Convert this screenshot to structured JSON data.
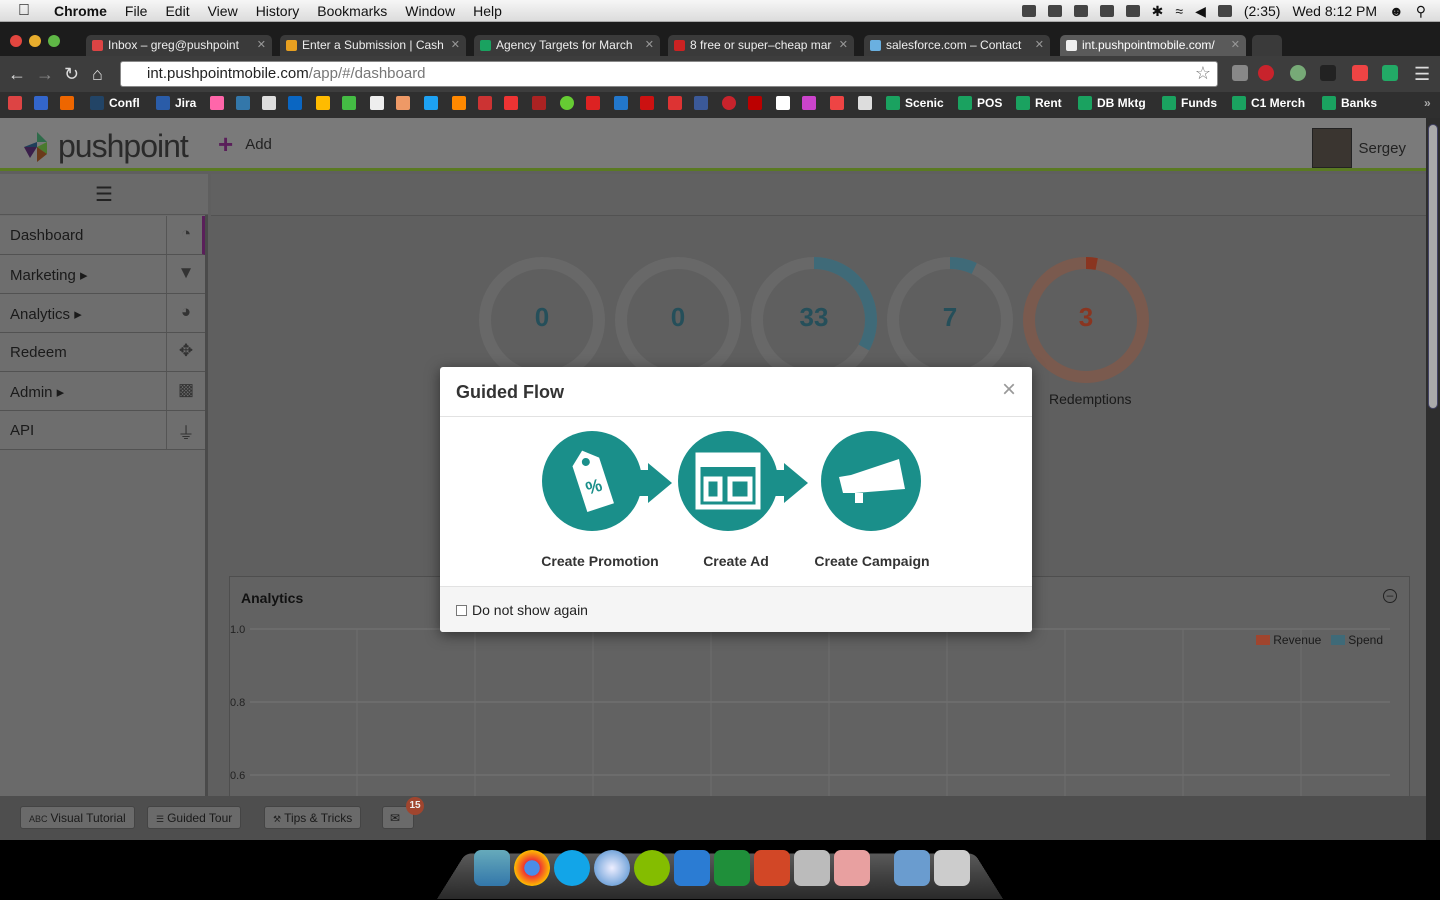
{
  "menubar": {
    "app": "Chrome",
    "items": [
      "File",
      "Edit",
      "View",
      "History",
      "Bookmarks",
      "Window",
      "Help"
    ],
    "battery": "(2:35)",
    "clock": "Wed 8:12 PM"
  },
  "tabs": [
    {
      "label": "Inbox – greg@pushpoint",
      "color": "#d44"
    },
    {
      "label": "Enter a Submission | Cash",
      "color": "#e8a020"
    },
    {
      "label": "Agency Targets for March",
      "color": "#1aa260"
    },
    {
      "label": "8 free or super–cheap mar",
      "color": "#c22"
    },
    {
      "label": "salesforce.com – Contact",
      "color": "#6ab0e0"
    },
    {
      "label": "int.pushpointmobile.com/",
      "color": "#eee"
    }
  ],
  "omnibox": {
    "host": "int.pushpointmobile.com",
    "path": "/app/#/dashboard"
  },
  "bookmarks": [
    {
      "label": "Confl"
    },
    {
      "label": "Jira"
    },
    {
      "label": "Scenic"
    },
    {
      "label": "POS"
    },
    {
      "label": "Rent"
    },
    {
      "label": "DB Mktg"
    },
    {
      "label": "Funds"
    },
    {
      "label": "C1 Merch"
    },
    {
      "label": "Banks"
    }
  ],
  "header": {
    "brand": "pushpoint",
    "add_label": "Add",
    "user_name": "Sergey"
  },
  "sidebar": {
    "items": [
      {
        "label": "Dashboard",
        "icon": "gauge-icon"
      },
      {
        "label": "Marketing ▸",
        "icon": "funnel-icon"
      },
      {
        "label": "Analytics ▸",
        "icon": "pie-icon"
      },
      {
        "label": "Redeem",
        "icon": "redeem-icon"
      },
      {
        "label": "Admin ▸",
        "icon": "briefcase-icon"
      },
      {
        "label": "API",
        "icon": "plug-icon"
      }
    ]
  },
  "stats": [
    {
      "value": "0",
      "fill": 0,
      "color": "#254f5a"
    },
    {
      "value": "0",
      "fill": 0,
      "color": "#254f5a"
    },
    {
      "value": "33",
      "fill": 0.33,
      "color": "#254f5a"
    },
    {
      "value": "7",
      "fill": 0.07,
      "color": "#254f5a"
    },
    {
      "value": "3",
      "fill": 0.03,
      "color": "#8a3520",
      "label": "Redemptions"
    }
  ],
  "analytics": {
    "title": "Analytics",
    "chart_data": {
      "type": "line",
      "ylim": [
        0.6,
        1.0
      ],
      "yticks": [
        "1.0",
        "0.8",
        "0.6"
      ],
      "series": [
        {
          "name": "Revenue",
          "color": "#a0452e",
          "values": []
        },
        {
          "name": "Spend",
          "color": "#3f6a78",
          "values": []
        }
      ],
      "grid": true,
      "legend": "top-right"
    }
  },
  "bottombar": {
    "visual_tutorial": "Visual Tutorial",
    "visual_tutorial_tag": "ABC",
    "guided_tour": "Guided Tour",
    "tips": "Tips & Tricks",
    "mail_count": "15"
  },
  "modal": {
    "title": "Guided Flow",
    "steps": [
      {
        "label": "Create Promotion",
        "icon": "price-tag-icon"
      },
      {
        "label": "Create Ad",
        "icon": "layout-icon"
      },
      {
        "label": "Create Campaign",
        "icon": "megaphone-icon"
      }
    ],
    "dont_show": "Do not show again",
    "accent": "#1a8f8a"
  }
}
